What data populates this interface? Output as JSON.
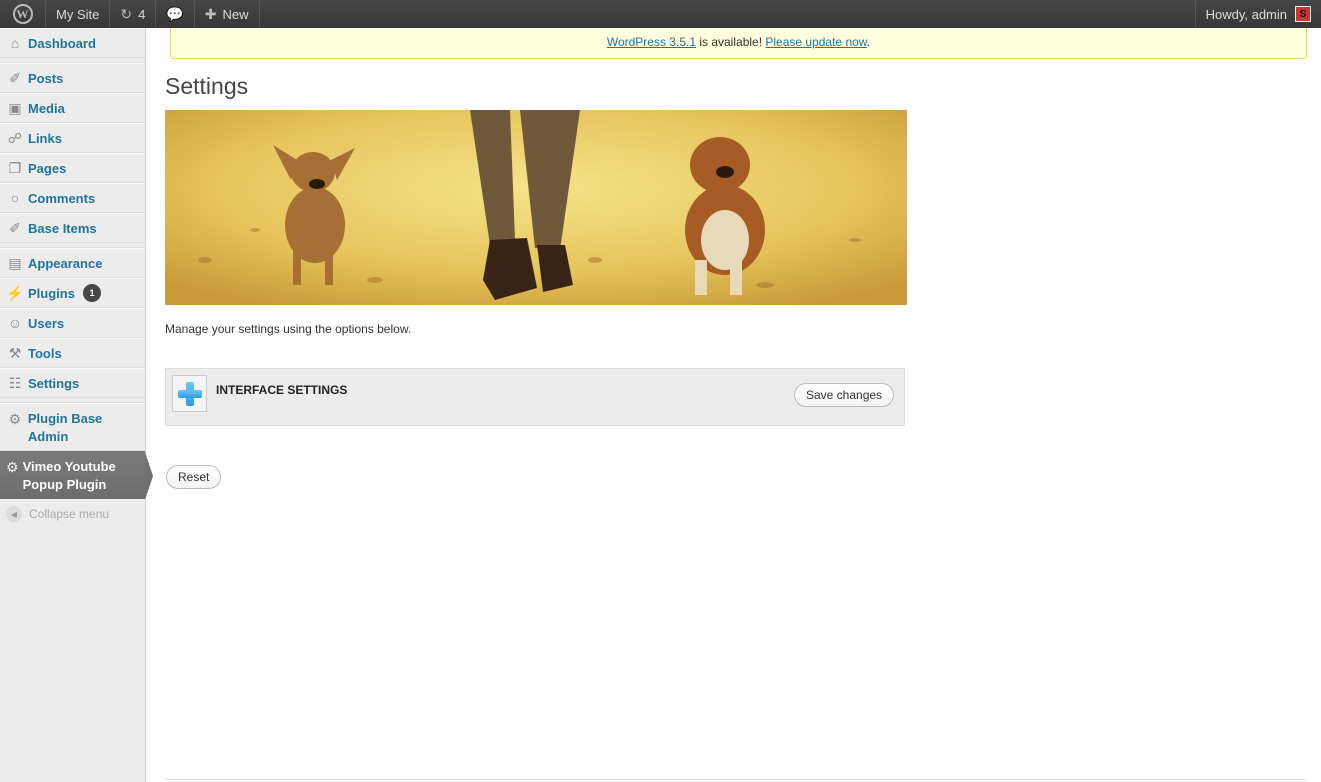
{
  "adminbar": {
    "site_name": "My Site",
    "updates_count": "4",
    "new_label": "New",
    "howdy": "Howdy, admin"
  },
  "sidebar": {
    "items": [
      {
        "label": "Dashboard",
        "icon": "house-icon"
      },
      {
        "label": "Posts",
        "icon": "pushpin-icon"
      },
      {
        "label": "Media",
        "icon": "media-icon"
      },
      {
        "label": "Links",
        "icon": "link-icon"
      },
      {
        "label": "Pages",
        "icon": "pages-icon"
      },
      {
        "label": "Comments",
        "icon": "comment-icon"
      },
      {
        "label": "Base Items",
        "icon": "pushpin-icon"
      },
      {
        "label": "Appearance",
        "icon": "appearance-icon"
      },
      {
        "label": "Plugins",
        "icon": "plugin-icon",
        "badge": "1"
      },
      {
        "label": "Users",
        "icon": "users-icon"
      },
      {
        "label": "Tools",
        "icon": "tools-icon"
      },
      {
        "label": "Settings",
        "icon": "settings-icon"
      },
      {
        "label": "Plugin Base Admin",
        "icon": "gear-icon"
      },
      {
        "label": "Vimeo Youtube Popup Plugin",
        "icon": "gear-icon",
        "current": true
      }
    ],
    "collapse_label": "Collapse menu"
  },
  "notice": {
    "version_link": "WordPress 3.5.1",
    "middle_text": " is available! ",
    "update_link": "Please update now",
    "end_text": "."
  },
  "page": {
    "title": "Settings",
    "description": "Manage your settings using the options below.",
    "panel_title": "INTERFACE SETTINGS",
    "save_label": "Save changes",
    "reset_label": "Reset"
  },
  "colors": {
    "link": "#21759b",
    "adminbar": "#464646",
    "notice_bg": "#ffffe0",
    "current_menu": "#6d6d6d"
  }
}
